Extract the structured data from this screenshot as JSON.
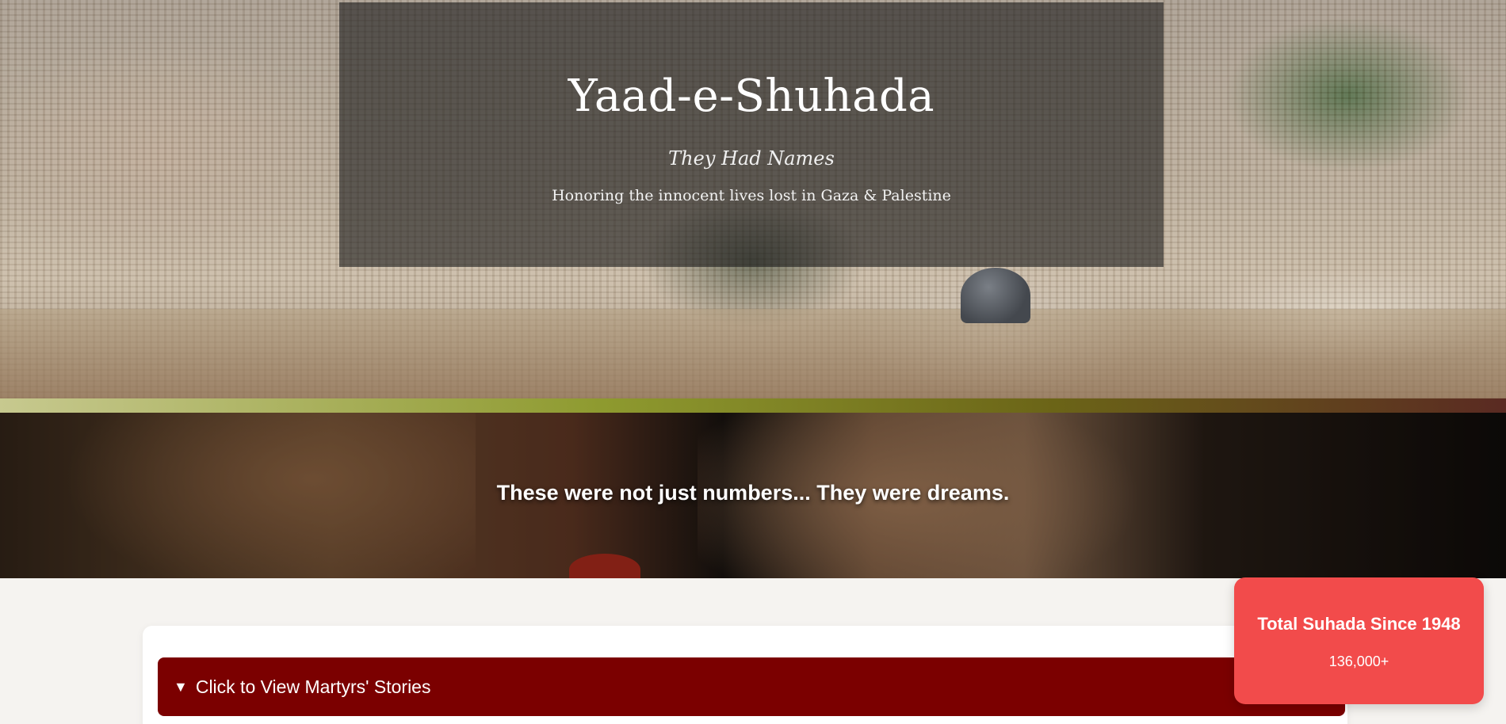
{
  "hero": {
    "title": "Yaad-e-Shuhada",
    "tagline": "They Had Names",
    "subtitle": "Honoring the innocent lives lost in Gaza & Palestine",
    "background_image": "aerial-view-al-aqsa"
  },
  "banner": {
    "text": "These were not just numbers... They were dreams.",
    "background_image": "grieving-mother-and-child"
  },
  "stories": {
    "toggle_icon": "triangle-down",
    "toggle_label": "Click to View Martyrs' Stories"
  },
  "stats": {
    "title": "Total Suhada Since 1948",
    "value": "136,000+"
  },
  "colors": {
    "toggle_bg": "#7b0000",
    "badge_bg": "#f24b4b",
    "page_bg": "#f5f3f0"
  }
}
